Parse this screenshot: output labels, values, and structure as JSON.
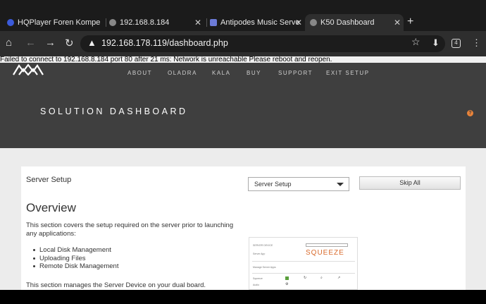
{
  "browser": {
    "tabs": [
      {
        "title": "HQPlayer Foren Kompe",
        "active": false
      },
      {
        "title": "192.168.8.184",
        "active": false
      },
      {
        "title": "Antipodes Music Server",
        "active": false
      },
      {
        "title": "K50 Dashboard",
        "active": true
      }
    ],
    "new_tab": "+",
    "url": "192.168.178.119/dashboard.php",
    "tab_count": "4",
    "icons": [
      "home-icon",
      "back-icon",
      "forward-icon",
      "reload-icon",
      "not-secure-icon",
      "star-icon",
      "download-icon",
      "menu-icon"
    ]
  },
  "error_message": "Failed to connect to 192.168.8.184 port 80 after 21 ms: Network is unreachable Please reboot and reopen.",
  "site": {
    "nav": [
      "ABOUT",
      "OLADRA",
      "KALA",
      "BUY",
      "SUPPORT",
      "EXIT SETUP"
    ],
    "hero_title": "SOLUTION DASHBOARD",
    "help": "?",
    "accent": "#e8833a"
  },
  "panel": {
    "title": "Server Setup",
    "select_value": "Server Setup",
    "skip_label": "Skip All",
    "heading": "Overview",
    "intro": "This section covers the setup required on the server prior to launching any applications:",
    "bullets": [
      "Local Disk Management",
      "Uploading Files",
      "Remote Disk Management"
    ],
    "footer": "This section manages the Server Device on your dual board."
  },
  "thumbnail": {
    "server_device": "SERVER DEVICE",
    "server_app": "Server App",
    "brand": "SQUEEZE",
    "manage": "Manage Server Apps",
    "row1": "Squeeze",
    "row2": "Audio"
  }
}
